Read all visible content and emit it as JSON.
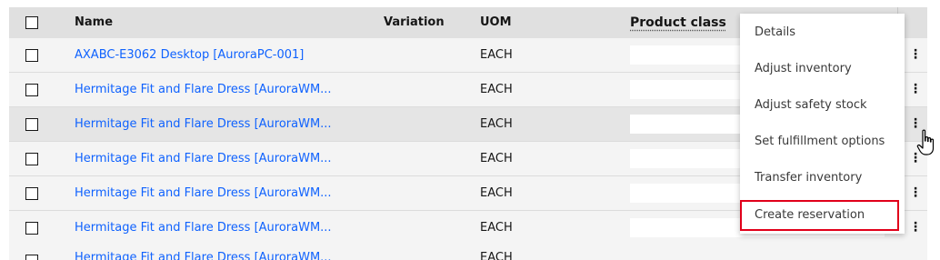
{
  "header": {
    "name": "Name",
    "variation": "Variation",
    "uom": "UOM",
    "product_class": "Product class"
  },
  "rows": [
    {
      "name": "AXABC-E3062 Desktop [AuroraPC-001]",
      "uom": "EACH"
    },
    {
      "name": "Hermitage Fit and Flare Dress [AuroraWM...",
      "uom": "EACH"
    },
    {
      "name": "Hermitage Fit and Flare Dress [AuroraWM...",
      "uom": "EACH"
    },
    {
      "name": "Hermitage Fit and Flare Dress [AuroraWM...",
      "uom": "EACH"
    },
    {
      "name": "Hermitage Fit and Flare Dress [AuroraWM...",
      "uom": "EACH"
    },
    {
      "name": "Hermitage Fit and Flare Dress [AuroraWM...",
      "uom": "EACH"
    },
    {
      "name": "Hermitage Fit and Flare Dress [AuroraWM...",
      "uom": "EACH"
    }
  ],
  "row_kebab": "⋮",
  "menu": {
    "items": [
      "Details",
      "Adjust inventory",
      "Adjust safety stock",
      "Set fulfillment options",
      "Transfer inventory",
      "Create reservation"
    ],
    "highlighted_index": 5
  },
  "colors": {
    "link": "#0f62fe",
    "header_bg": "#e0e0e0",
    "row_bg": "#f4f4f4",
    "row_hover_bg": "#e5e5e5",
    "highlight_border": "#e1001a"
  },
  "icons": {
    "row_actions": "overflow-menu-vertical-icon",
    "pointer": "hand-pointer-cursor-icon"
  }
}
